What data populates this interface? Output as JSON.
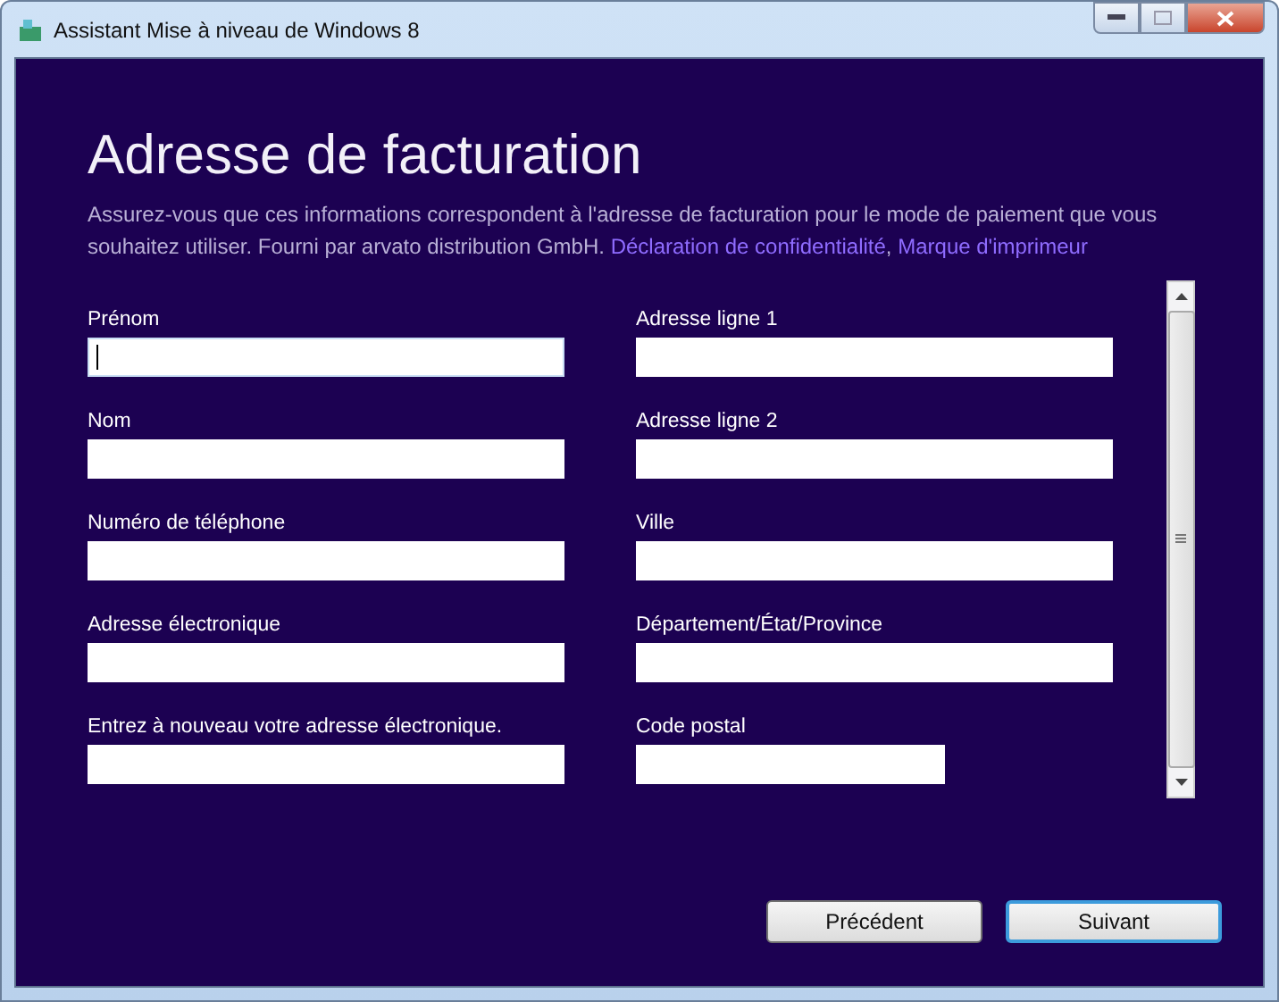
{
  "window": {
    "title": "Assistant Mise à niveau de Windows 8"
  },
  "heading": "Adresse de facturation",
  "description": {
    "text": "Assurez-vous que ces informations correspondent à l'adresse de facturation pour le mode de paiement que vous souhaitez utiliser. Fourni par arvato distribution GmbH.",
    "links": [
      "Déclaration de confidentialité",
      "Marque d'imprimeur"
    ],
    "link_separator": ","
  },
  "columns": [
    [
      {
        "label": "Prénom",
        "kind": "wide",
        "focused": true
      },
      {
        "label": "Nom",
        "kind": "wide",
        "focused": false
      },
      {
        "label": "Numéro de téléphone",
        "kind": "wide",
        "focused": false
      },
      {
        "label": "Adresse électronique",
        "kind": "wide",
        "focused": false
      },
      {
        "label": "Entrez à nouveau votre adresse électronique.",
        "kind": "wide",
        "focused": false
      }
    ],
    [
      {
        "label": "Adresse ligne 1",
        "kind": "wide",
        "focused": false
      },
      {
        "label": "Adresse ligne 2",
        "kind": "wide",
        "focused": false
      },
      {
        "label": "Ville",
        "kind": "wide",
        "focused": false
      },
      {
        "label": "Département/État/Province",
        "kind": "wide",
        "focused": false
      },
      {
        "label": "Code postal",
        "kind": "short",
        "focused": false
      }
    ]
  ],
  "buttons": [
    {
      "label": "Précédent",
      "focused": false
    },
    {
      "label": "Suivant",
      "focused": true
    }
  ]
}
